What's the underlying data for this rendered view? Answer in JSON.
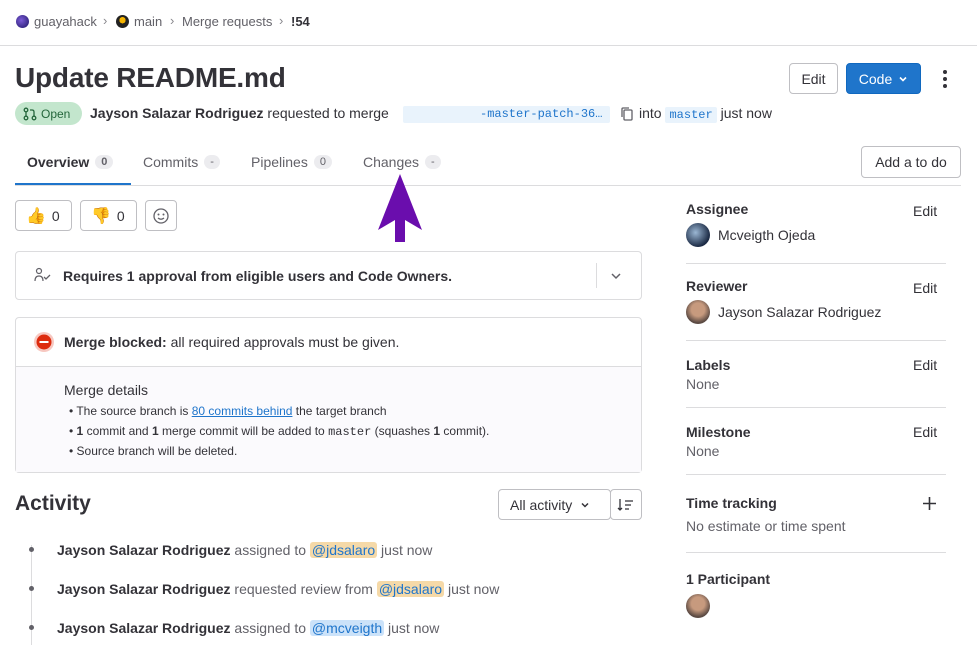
{
  "breadcrumb": [
    {
      "label": "guayahack"
    },
    {
      "label": "main"
    },
    {
      "label": "Merge requests"
    },
    {
      "label": "!54"
    }
  ],
  "title": "Update README.md",
  "header_buttons": {
    "edit": "Edit",
    "code": "Code"
  },
  "status": {
    "label": "Open",
    "color": "#c3e6cd"
  },
  "meta": {
    "author": "Jayson Salazar Rodriguez",
    "action": "requested to merge",
    "source_branch": "-master-patch-36…",
    "into": "into",
    "target_branch": "master",
    "time": "just now"
  },
  "tabs": [
    {
      "label": "Overview",
      "count": "0"
    },
    {
      "label": "Commits",
      "count": "-"
    },
    {
      "label": "Pipelines",
      "count": "0"
    },
    {
      "label": "Changes",
      "count": "-"
    }
  ],
  "add_todo": "Add a to do",
  "reactions": {
    "thumbs_up": "0",
    "thumbs_down": "0"
  },
  "approval": {
    "text": "Requires 1 approval from eligible users and Code Owners."
  },
  "merge": {
    "blocked_label": "Merge blocked:",
    "blocked_text": "all required approvals must be given.",
    "details_title": "Merge details",
    "item1_pre": "The source branch is",
    "item1_link": "80 commits behind",
    "item1_post": "the target branch",
    "item2_n1": "1",
    "item2_a": "commit and",
    "item2_n2": "1",
    "item2_b": "merge commit will be added to",
    "item2_branch": "master",
    "item2_c": "(squashes",
    "item2_n3": "1",
    "item2_d": "commit).",
    "item3": "Source branch will be deleted."
  },
  "activity": {
    "title": "Activity",
    "filter": "All activity",
    "items": [
      {
        "author": "Jayson Salazar Rodriguez",
        "action": "assigned to",
        "mention": "@jdsalaro",
        "time": "just now"
      },
      {
        "author": "Jayson Salazar Rodriguez",
        "action": "requested review from",
        "mention": "@jdsalaro",
        "time": "just now"
      },
      {
        "author": "Jayson Salazar Rodriguez",
        "action": "assigned to",
        "mention": "@mcveigth",
        "time": "just now"
      }
    ]
  },
  "sidebar": {
    "edit": "Edit",
    "assignee": {
      "title": "Assignee",
      "name": "Mcveigth Ojeda"
    },
    "reviewer": {
      "title": "Reviewer",
      "name": "Jayson Salazar Rodriguez"
    },
    "labels": {
      "title": "Labels",
      "value": "None"
    },
    "milestone": {
      "title": "Milestone",
      "value": "None"
    },
    "time_tracking": {
      "title": "Time tracking",
      "value": "No estimate or time spent"
    },
    "participants": {
      "title": "1 Participant"
    }
  },
  "colors": {
    "accent": "#1f75cb",
    "annotation_arrow": "#6a0dad"
  }
}
